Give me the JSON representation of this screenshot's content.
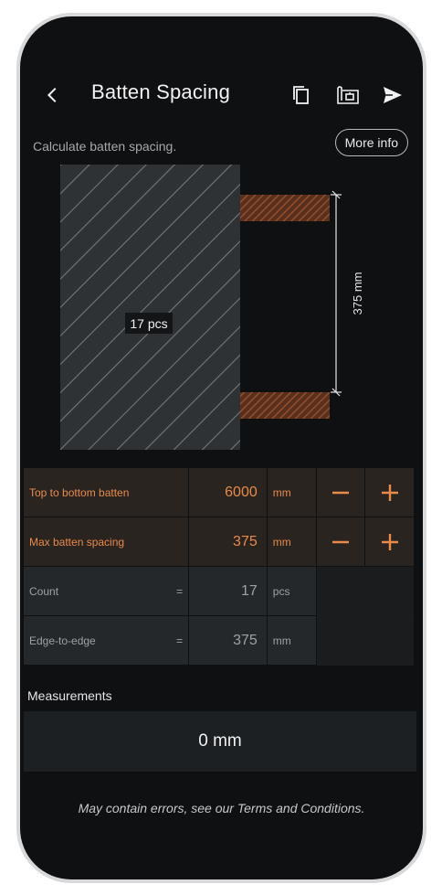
{
  "header": {
    "title": "Batten Spacing",
    "back_icon": "chevron-left-icon",
    "icons": [
      "copy-icon",
      "floorplan-icon",
      "send-icon"
    ]
  },
  "intro": {
    "subtitle": "Calculate batten spacing.",
    "more_info_label": "More info"
  },
  "diagram": {
    "count_label": "17 pcs",
    "dimension_label": "375 mm"
  },
  "inputs": [
    {
      "label": "Top to bottom batten",
      "value": "6000",
      "unit": "mm"
    },
    {
      "label": "Max batten spacing",
      "value": "375",
      "unit": "mm"
    }
  ],
  "outputs": [
    {
      "label": "Count",
      "eq": "=",
      "value": "17",
      "unit": "pcs"
    },
    {
      "label": "Edge-to-edge",
      "eq": "=",
      "value": "375",
      "unit": "mm"
    }
  ],
  "measurements": {
    "label": "Measurements",
    "value": "0 mm"
  },
  "footer": {
    "disclaimer": "May contain errors, see our Terms and Conditions."
  },
  "colors": {
    "accent": "#e88a4a",
    "background": "#0f1012",
    "input_row_bg": "#2a2421",
    "output_row_bg": "#25282b",
    "batten_brown": "#8a4a2c"
  }
}
